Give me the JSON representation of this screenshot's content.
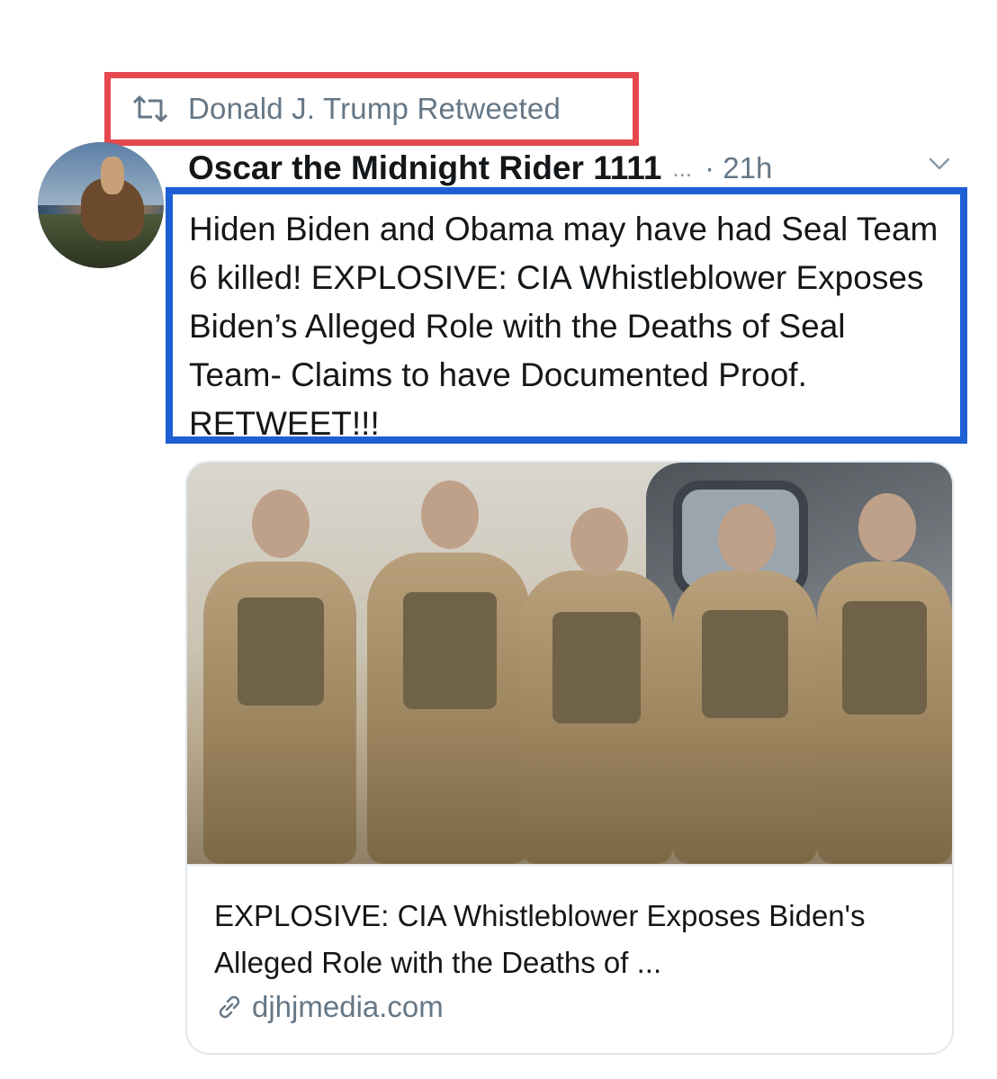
{
  "social_context": {
    "text": "Donald J. Trump Retweeted",
    "icon": "retweet-icon",
    "highlight_color": "#e5484d"
  },
  "tweet": {
    "display_name": "Oscar the Midnight Rider 1111",
    "truncation": "...",
    "timestamp": "· 21h",
    "menu_icon": "chevron-down-icon",
    "text": "Hiden Biden and Obama may have had Seal Team 6 killed! EXPLOSIVE: CIA Whistleblower Exposes Biden’s Alleged Role with the Deaths of Seal Team- Claims to have Documented Proof. RETWEET!!!",
    "highlight_color": "#1f5fd6"
  },
  "link_card": {
    "title": "EXPLOSIVE: CIA Whistleblower Exposes Biden's Alleged Role with the Deaths of ...",
    "domain": "djhjmedia.com",
    "domain_icon": "link-icon"
  }
}
